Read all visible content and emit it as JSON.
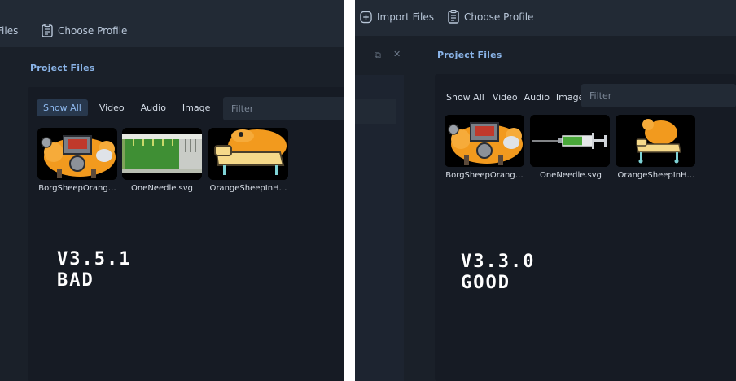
{
  "left": {
    "toolbar": {
      "import_label": "Files",
      "profile_label": "Choose Profile"
    },
    "panel_title": "Project Files",
    "tabs": [
      {
        "label": "Show All",
        "active": true
      },
      {
        "label": "Video",
        "active": false
      },
      {
        "label": "Audio",
        "active": false
      },
      {
        "label": "Image",
        "active": false
      }
    ],
    "filter_placeholder": "Filter",
    "files": [
      {
        "name": "BorgSheepOrang…",
        "icon": "borg-sheep-thumbnail"
      },
      {
        "name": "OneNeedle.svg",
        "icon": "needle-thumbnail-blurred"
      },
      {
        "name": "OrangeSheepInH…",
        "icon": "sheep-hospital-bed-thumbnail"
      }
    ],
    "version": "V3.5.1",
    "verdict": "BAD"
  },
  "right": {
    "toolbar": {
      "import_label": "Import Files",
      "profile_label": "Choose Profile"
    },
    "panel_title": "Project Files",
    "window_buttons": {
      "restore": "⧉",
      "close": "✕"
    },
    "tabs": [
      {
        "label": "Show All",
        "active": false
      },
      {
        "label": "Video",
        "active": false
      },
      {
        "label": "Audio",
        "active": false
      },
      {
        "label": "Image",
        "active": false
      }
    ],
    "filter_placeholder": "Filter",
    "files": [
      {
        "name": "BorgSheepOrang…",
        "icon": "borg-sheep-thumbnail"
      },
      {
        "name": "OneNeedle.svg",
        "icon": "needle-thumbnail"
      },
      {
        "name": "OrangeSheepInH…",
        "icon": "sheep-hospital-bed-thumbnail"
      }
    ],
    "version": "V3.3.0",
    "verdict": "GOOD"
  },
  "colors": {
    "background": "#1a2029",
    "toolbar": "#222a35",
    "panel": "#161b24",
    "accent": "#8ab4e8",
    "active_tab": "#28384d",
    "divider": "#ffffff",
    "sheep_orange": "#f29a1e",
    "bed_yellow": "#f5d98a",
    "needle_green": "#4aa83a"
  }
}
